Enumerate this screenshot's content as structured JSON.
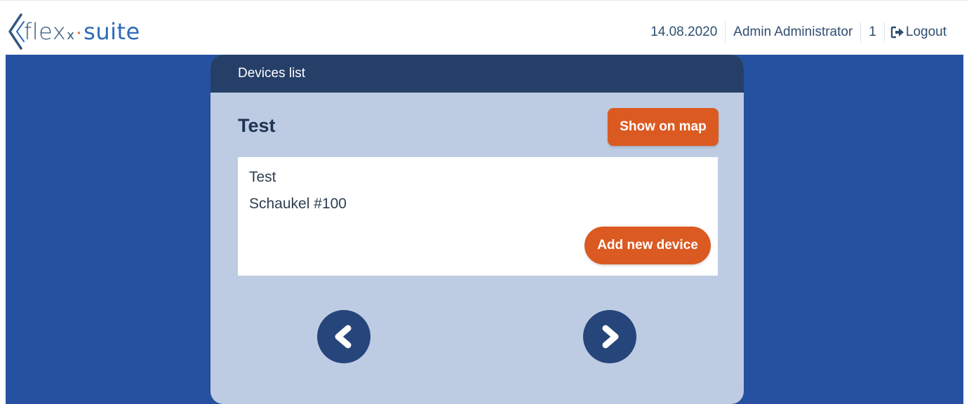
{
  "header": {
    "logo": {
      "part_flex": "flex",
      "part_x": "x",
      "part_dot": "·",
      "part_suite": "suite"
    },
    "date": "14.08.2020",
    "user_name": "Admin Administrator",
    "count": "1",
    "logout_label": "Logout"
  },
  "panel": {
    "header_title": "Devices list",
    "title": "Test",
    "show_on_map_label": "Show on map",
    "card": {
      "line1": "Test",
      "line2": "Schaukel #100"
    },
    "add_device_label": "Add new device"
  },
  "navigation": {
    "prev_icon": "chevron-left-icon",
    "next_icon": "chevron-right-icon"
  },
  "colors": {
    "background_blue": "#2651a0",
    "panel_bg": "#bdcce2",
    "panel_header": "#253f68",
    "accent_orange": "#db5a22",
    "nav_button": "#26457a"
  }
}
